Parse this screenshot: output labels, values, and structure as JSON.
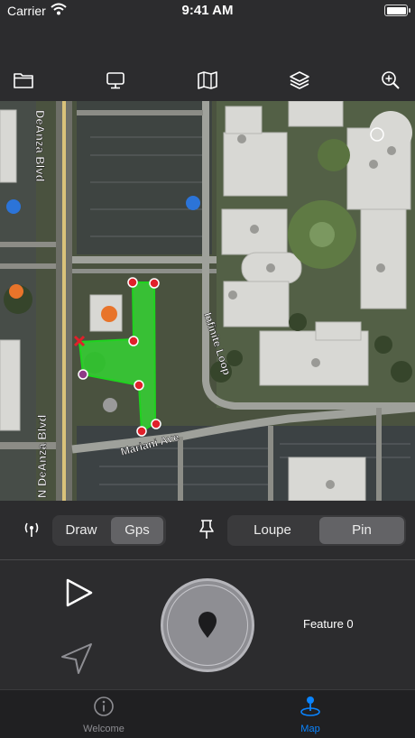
{
  "status_bar": {
    "carrier": "Carrier",
    "time": "9:41 AM"
  },
  "toolbar": {
    "icons": [
      "folder-icon",
      "desktop-icon",
      "map-icon",
      "layers-icon",
      "zoom-in-icon"
    ]
  },
  "map": {
    "streets": [
      "N De Anza Blvd",
      "DeAnza Blvd",
      "N DeAnza Blvd",
      "Infinite Loop",
      "Mariani Ave"
    ]
  },
  "mode_segment": {
    "options": [
      "Draw",
      "Gps"
    ],
    "selected": "Gps"
  },
  "view_segment": {
    "options": [
      "Loupe",
      "Pin"
    ],
    "selected": "Pin"
  },
  "panel": {
    "feature_label": "Feature 0"
  },
  "tab_bar": {
    "tabs": [
      {
        "label": "Welcome",
        "icon": "info-icon",
        "active": false
      },
      {
        "label": "Map",
        "icon": "map-pin-icon",
        "active": true
      }
    ],
    "active_color": "#0a84ff",
    "inactive_color": "#8e8e93"
  },
  "colors": {
    "polygon": "#2ee62e",
    "vertex": "#e0202a",
    "accent": "#0a84ff"
  }
}
